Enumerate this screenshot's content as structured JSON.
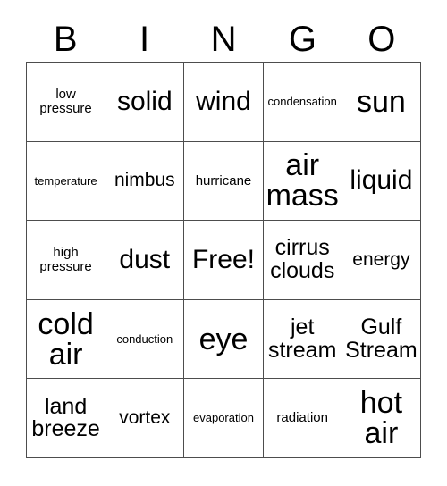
{
  "card": {
    "title": "BINGO",
    "header_letters": [
      "B",
      "I",
      "N",
      "G",
      "O"
    ],
    "free_space_label": "Free!",
    "border_color": "#4d4d4d",
    "text_color": "#000000",
    "cell_background": "#ffffff"
  },
  "rows": [
    {
      "cells": [
        {
          "text": "low\npressure",
          "size": "sz-s"
        },
        {
          "text": "solid",
          "size": "sz-xl"
        },
        {
          "text": "wind",
          "size": "sz-xl"
        },
        {
          "text": "condensation",
          "size": "sz-xs"
        },
        {
          "text": "sun",
          "size": "sz-xxl"
        }
      ]
    },
    {
      "cells": [
        {
          "text": "temperature",
          "size": "sz-xs"
        },
        {
          "text": "nimbus",
          "size": "sz-m"
        },
        {
          "text": "hurricane",
          "size": "sz-s"
        },
        {
          "text": "air\nmass",
          "size": "sz-xxl"
        },
        {
          "text": "liquid",
          "size": "sz-xl"
        }
      ]
    },
    {
      "cells": [
        {
          "text": "high\npressure",
          "size": "sz-s"
        },
        {
          "text": "dust",
          "size": "sz-xl"
        },
        {
          "text": "Free!",
          "size": "sz-xl"
        },
        {
          "text": "cirrus\nclouds",
          "size": "sz-l"
        },
        {
          "text": "energy",
          "size": "sz-m"
        }
      ]
    },
    {
      "cells": [
        {
          "text": "cold\nair",
          "size": "sz-xxl"
        },
        {
          "text": "conduction",
          "size": "sz-xs"
        },
        {
          "text": "eye",
          "size": "sz-xxl"
        },
        {
          "text": "jet\nstream",
          "size": "sz-l"
        },
        {
          "text": "Gulf\nStream",
          "size": "sz-l"
        }
      ]
    },
    {
      "cells": [
        {
          "text": "land\nbreeze",
          "size": "sz-l"
        },
        {
          "text": "vortex",
          "size": "sz-m"
        },
        {
          "text": "evaporation",
          "size": "sz-xs"
        },
        {
          "text": "radiation",
          "size": "sz-s"
        },
        {
          "text": "hot\nair",
          "size": "sz-xxl"
        }
      ]
    }
  ]
}
